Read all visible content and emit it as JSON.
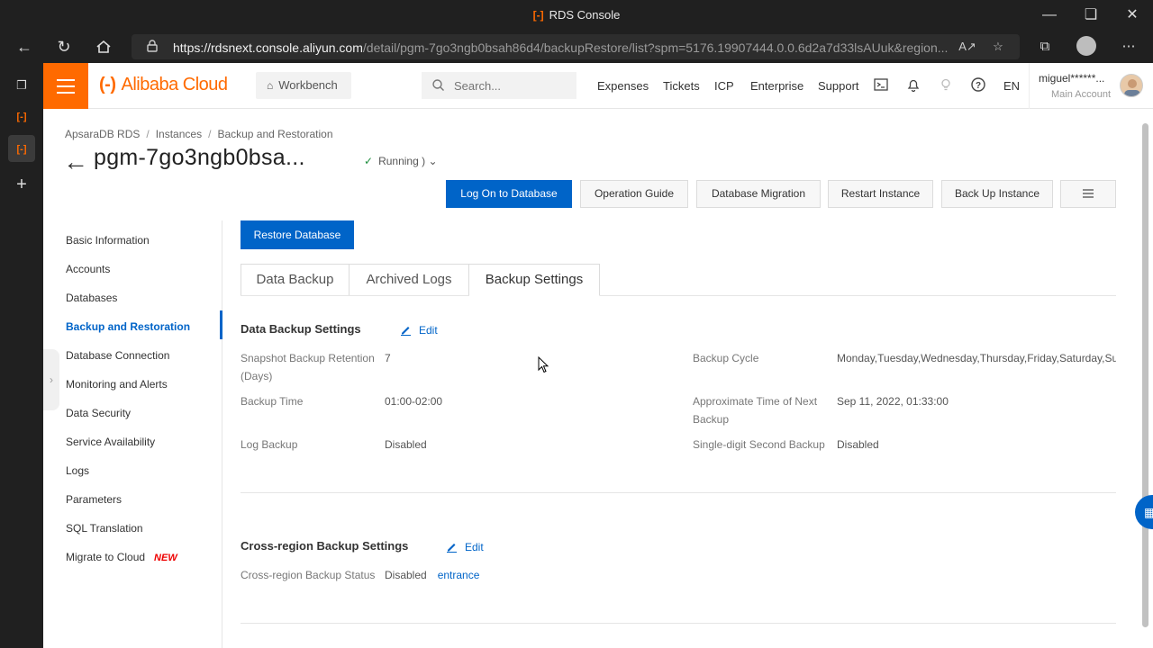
{
  "browser": {
    "window_title": "RDS Console",
    "url_host": "https://rdsnext.console.aliyun.com",
    "url_path": "/detail/pgm-7go3ngb0bsah86d4/backupRestore/list?spm=5176.19907444.0.0.6d2a7d33lsAUuk&region...",
    "title_logo": "[-]"
  },
  "topnav": {
    "brand": "Alibaba Cloud",
    "brand_mark": "(-)",
    "workbench": "Workbench",
    "search_placeholder": "Search...",
    "links": [
      "Expenses",
      "Tickets",
      "ICP",
      "Enterprise",
      "Support"
    ],
    "language": "EN",
    "user_name": "miguel******...",
    "user_role": "Main Account"
  },
  "breadcrumb": [
    "ApsaraDB RDS",
    "Instances",
    "Backup and Restoration"
  ],
  "instance": {
    "title": "pgm-7go3ngb0bsa...",
    "status": "Running )"
  },
  "actions": {
    "logon": "Log On to Database",
    "guide": "Operation Guide",
    "migration": "Database Migration",
    "restart": "Restart Instance",
    "backup": "Back Up Instance"
  },
  "sidebar": {
    "items": [
      "Basic Information",
      "Accounts",
      "Databases",
      "Backup and Restoration",
      "Database Connection",
      "Monitoring and Alerts",
      "Data Security",
      "Service Availability",
      "Logs",
      "Parameters",
      "SQL Translation",
      "Migrate to Cloud"
    ],
    "new_badge": "NEW"
  },
  "restore_button": "Restore Database",
  "tabs": [
    "Data Backup",
    "Archived Logs",
    "Backup Settings"
  ],
  "data_backup_settings": {
    "title": "Data Backup Settings",
    "edit": "Edit",
    "snapshot_label": "Snapshot Backup Retention (Days)",
    "snapshot_value": "7",
    "cycle_label": "Backup Cycle",
    "cycle_value": "Monday,Tuesday,Wednesday,Thursday,Friday,Saturday,Sun",
    "time_label": "Backup Time",
    "time_value": "01:00-02:00",
    "next_label": "Approximate Time of Next Backup",
    "next_value": "Sep 11, 2022, 01:33:00",
    "log_label": "Log Backup",
    "log_value": "Disabled",
    "second_label": "Single-digit Second Backup",
    "second_value": "Disabled"
  },
  "cross_region": {
    "title": "Cross-region Backup Settings",
    "edit": "Edit",
    "status_label": "Cross-region Backup Status",
    "status_value": "Disabled",
    "link": "entrance"
  }
}
